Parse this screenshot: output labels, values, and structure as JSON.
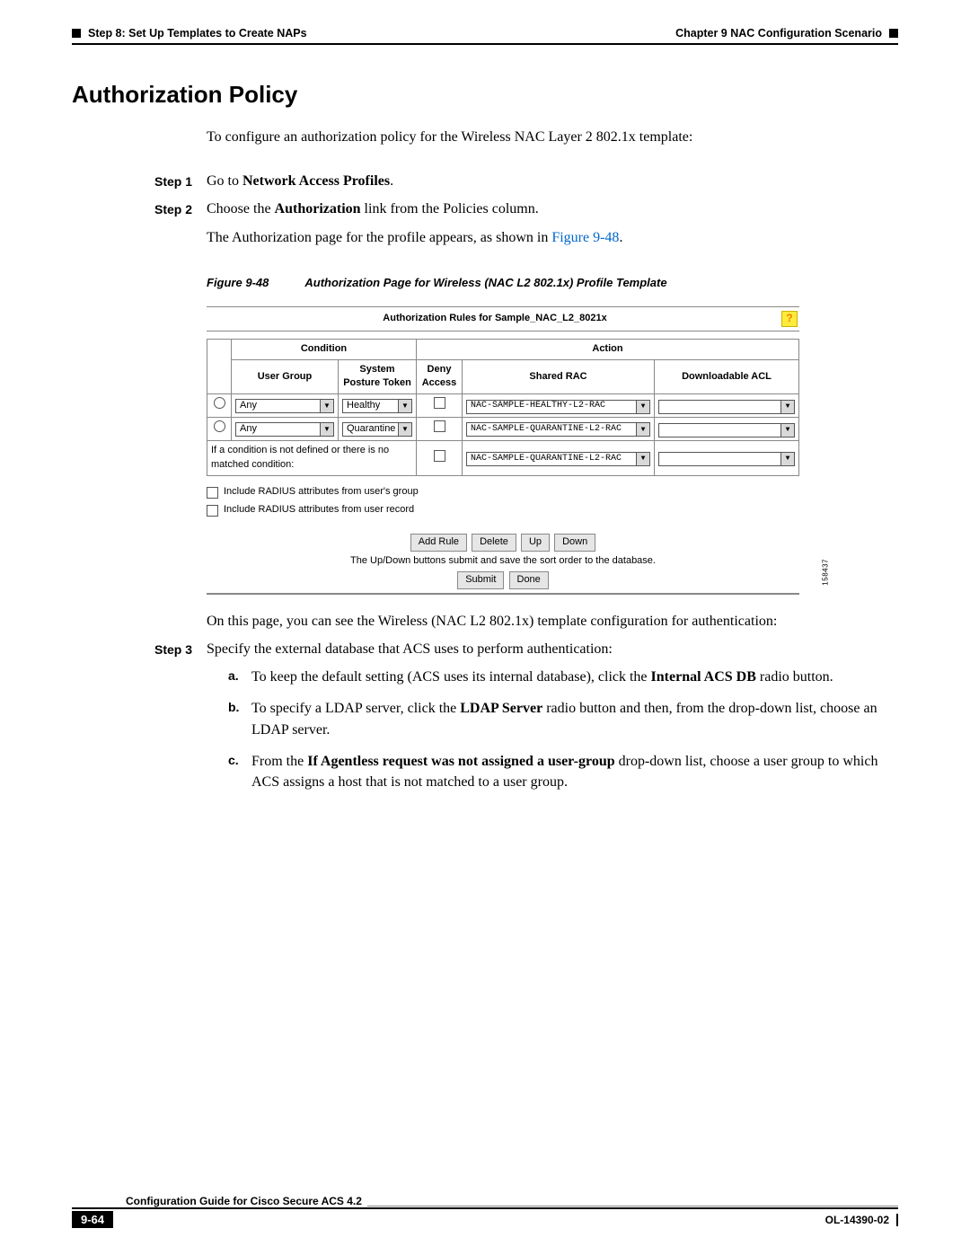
{
  "header": {
    "left": "Step 8: Set Up Templates to Create NAPs",
    "right": "Chapter 9    NAC Configuration Scenario"
  },
  "title": "Authorization Policy",
  "intro": "To configure an authorization policy for the Wireless NAC Layer 2 802.1x template:",
  "steps": {
    "s1_label": "Step 1",
    "s1_pre": "Go to ",
    "s1_bold": "Network Access Profiles",
    "s1_post": ".",
    "s2_label": "Step 2",
    "s2a_pre": "Choose the ",
    "s2a_bold": "Authorization",
    "s2a_post": " link from the Policies column.",
    "s2b_pre": "The Authorization page for the profile appears, as shown in ",
    "s2b_link": "Figure 9-48",
    "s2b_post": ".",
    "s3_label": "Step 3",
    "s3_text": "Specify the external database that ACS uses to perform authentication:"
  },
  "figure": {
    "label": "Figure 9-48",
    "caption": "Authorization Page for Wireless (NAC L2 802.1x) Profile Template",
    "title": "Authorization Rules for Sample_NAC_L2_8021x",
    "headers": {
      "condition": "Condition",
      "action": "Action",
      "user_group": "User Group",
      "posture": "System Posture Token",
      "deny": "Deny Access",
      "shared_rac": "Shared RAC",
      "dacl": "Downloadable ACL"
    },
    "rows": [
      {
        "ug": "Any",
        "posture": "Healthy",
        "rac": "NAC-SAMPLE-HEALTHY-L2-RAC",
        "dacl": ""
      },
      {
        "ug": "Any",
        "posture": "Quarantine",
        "rac": "NAC-SAMPLE-QUARANTINE-L2-RAC",
        "dacl": ""
      }
    ],
    "unmatched_text": "If a condition is not defined or there is no matched condition:",
    "unmatched_rac": "NAC-SAMPLE-QUARANTINE-L2-RAC",
    "include1": "Include RADIUS attributes from user's group",
    "include2": "Include RADIUS attributes from user record",
    "buttons": {
      "add": "Add Rule",
      "delete": "Delete",
      "up": "Up",
      "down": "Down",
      "submit": "Submit",
      "done": "Done"
    },
    "note": "The Up/Down buttons submit and save the sort order to the database.",
    "code": "158437"
  },
  "after_figure": "On this page, you can see the Wireless (NAC L2 802.1x) template configuration for authentication:",
  "sub": {
    "a_label": "a.",
    "a_pre": "To keep the default setting (ACS uses its internal database), click the ",
    "a_bold": "Internal ACS DB",
    "a_post": " radio button.",
    "b_label": "b.",
    "b_pre": "To specify a LDAP server, click the ",
    "b_bold": "LDAP Server",
    "b_post": " radio button and then, from the drop-down list, choose an LDAP server.",
    "c_label": "c.",
    "c_pre": "From the ",
    "c_bold": "If Agentless request was not assigned a user-group",
    "c_post": " drop-down list, choose a user group to which ACS assigns a host that is not matched to a user group."
  },
  "footer": {
    "guide": "Configuration Guide for Cisco Secure ACS 4.2",
    "page": "9-64",
    "doc": "OL-14390-02"
  }
}
